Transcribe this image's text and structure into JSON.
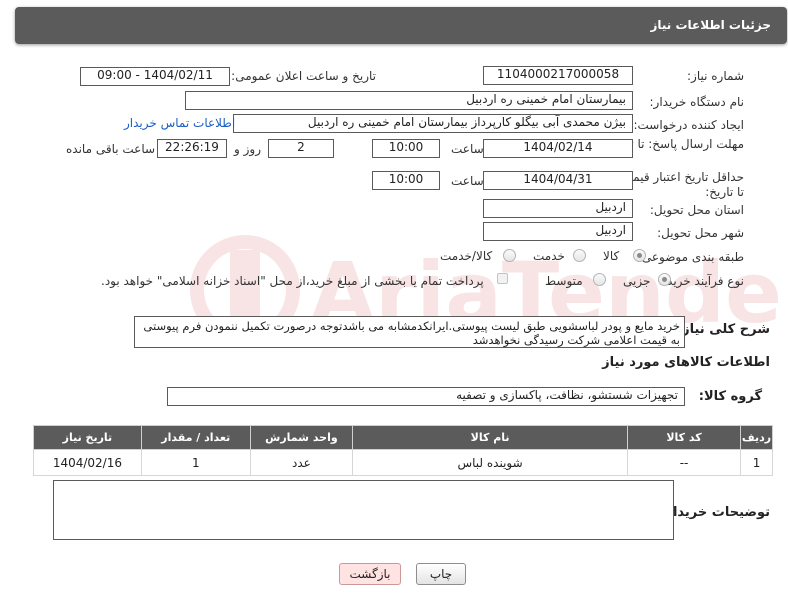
{
  "header": {
    "title": "جزئیات اطلاعات نیاز"
  },
  "form": {
    "need_number": {
      "label": "شماره نیاز:",
      "value": "1104000217000058"
    },
    "announce_datetime": {
      "label": "تاریخ و ساعت اعلان عمومی:",
      "value": "1404/02/11 - 09:00"
    },
    "buyer_org": {
      "label": "نام دستگاه خریدار:",
      "value": "بیمارستان امام خمینی  ره  اردبیل"
    },
    "requester": {
      "label": "ایجاد کننده درخواست:",
      "value": "بیژن محمدی آبی بیگلو کارپرداز بیمارستان امام خمینی  ره  اردبیل",
      "contact_link": "اطلاعات تماس خریدار"
    },
    "reply_deadline": {
      "label": "مهلت ارسال پاسخ: تا تاریخ:",
      "date": "1404/02/14",
      "time_label": "ساعت",
      "time": "10:00",
      "days": "2",
      "days_label": "روز و",
      "remaining": "22:26:19",
      "remaining_label": "ساعت باقی مانده"
    },
    "price_validity": {
      "label": "حداقل تاریخ اعتبار قیمت: تا تاریخ:",
      "date": "1404/04/31",
      "time_label": "ساعت",
      "time": "10:00"
    },
    "delivery_province": {
      "label": "استان محل تحویل:",
      "value": "اردبیل"
    },
    "delivery_city": {
      "label": "شهر محل تحویل:",
      "value": "اردبیل"
    },
    "category": {
      "label": "طبقه بندی موضوعی:",
      "options": [
        "کالا",
        "خدمت",
        "کالا/خدمت"
      ],
      "selected": "کالا"
    },
    "process_type": {
      "label": "نوع فرآیند خرید :",
      "options": [
        "جزیی",
        "متوسط"
      ],
      "payment_note": "پرداخت تمام یا بخشی از مبلغ خرید،از محل \"اسناد خزانه اسلامی\" خواهد بود."
    }
  },
  "description": {
    "label": "شرح کلی نیاز:",
    "text": "خرید مایع و پودر  لباسشویی طبق لیست پیوستی.ایرانکدمشابه می باشدتوجه درصورت تکمیل ننمودن فرم پیوستی به قیمت اعلامی شرکت رسیدگی نخواهدشد"
  },
  "goods_section": {
    "title": "اطلاعات کالاهای مورد نیاز",
    "group_label": "گروه کالا:",
    "group_value": "تجهیزات شستشو، نظافت، پاکسازی و تصفیه"
  },
  "table": {
    "headers": [
      "ردیف",
      "کد کالا",
      "نام کالا",
      "واحد شمارش",
      "تعداد / مقدار",
      "تاریخ نیاز"
    ],
    "rows": [
      [
        "1",
        "--",
        "شوینده لباس",
        "عدد",
        "1",
        "1404/02/16"
      ]
    ]
  },
  "buyer_notes": {
    "label": "توضیحات خریدار:",
    "value": ""
  },
  "buttons": {
    "print": "چاپ",
    "back": "بازگشت"
  },
  "colors": {
    "header_bg": "#5b5b5b",
    "link": "#1a5ec4",
    "back_button_bg": "#ffe3e3"
  }
}
